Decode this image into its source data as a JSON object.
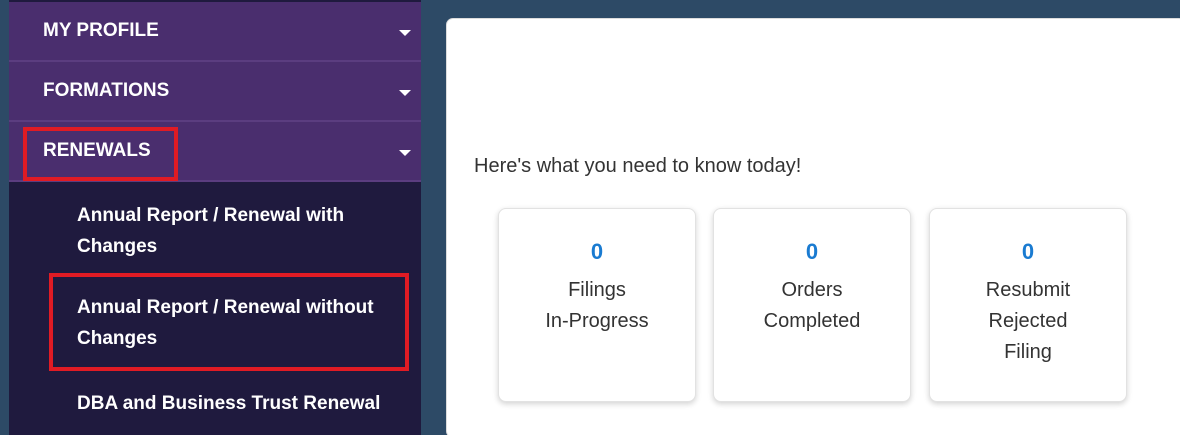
{
  "sidebar": {
    "headers": [
      {
        "label": "MY PROFILE"
      },
      {
        "label": "FORMATIONS"
      },
      {
        "label": "RENEWALS"
      }
    ],
    "submenu": [
      {
        "label": "Annual Report / Renewal with\nChanges"
      },
      {
        "label": "Annual Report / Renewal without\nChanges"
      },
      {
        "label": "DBA and Business Trust Renewal"
      }
    ]
  },
  "main": {
    "intro": "Here's what you need to know today!",
    "cards": [
      {
        "count": "0",
        "label": "Filings\nIn-Progress"
      },
      {
        "count": "0",
        "label": "Orders\nCompleted"
      },
      {
        "count": "0",
        "label": "Resubmit\nRejected\nFiling"
      }
    ]
  },
  "colors": {
    "sidebar_bg": "#1f1a3e",
    "header_bg": "#4a2e6e",
    "highlight": "#e01b24",
    "count_blue": "#1a7bd1"
  }
}
